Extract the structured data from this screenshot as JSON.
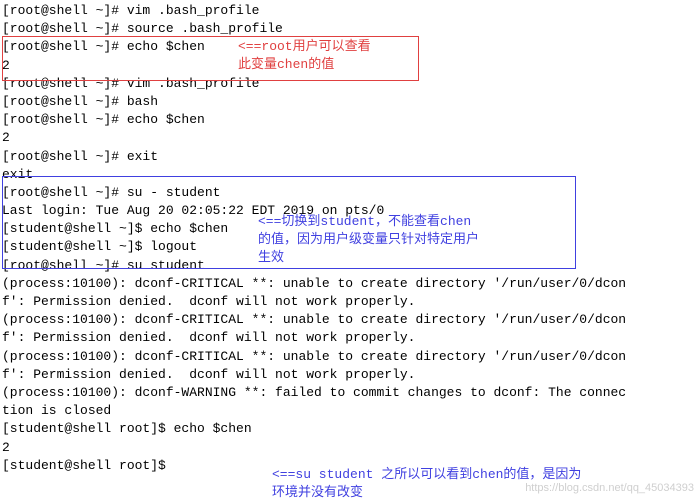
{
  "lines": [
    "[root@shell ~]# vim .bash_profile",
    "[root@shell ~]# source .bash_profile",
    "[root@shell ~]# echo $chen",
    "2",
    "[root@shell ~]# vim .bash_profile",
    "[root@shell ~]# bash",
    "[root@shell ~]# echo $chen",
    "2",
    "[root@shell ~]# exit",
    "exit",
    "[root@shell ~]# su - student",
    "Last login: Tue Aug 20 02:05:22 EDT 2019 on pts/0",
    "[student@shell ~]$ echo $chen",
    "",
    "[student@shell ~]$ logout",
    "[root@shell ~]# su student",
    "",
    "(process:10100): dconf-CRITICAL **: unable to create directory '/run/user/0/dcon",
    "f': Permission denied.  dconf will not work properly.",
    "",
    "(process:10100): dconf-CRITICAL **: unable to create directory '/run/user/0/dcon",
    "f': Permission denied.  dconf will not work properly.",
    "",
    "(process:10100): dconf-CRITICAL **: unable to create directory '/run/user/0/dcon",
    "f': Permission denied.  dconf will not work properly.",
    "",
    "(process:10100): dconf-WARNING **: failed to commit changes to dconf: The connec",
    "tion is closed",
    "[student@shell root]$ echo $chen",
    "2",
    "[student@shell root]$ "
  ],
  "annotations": {
    "red1": "<==root用户可以查看",
    "red2": "此变量chen的值",
    "blue1": "<==切换到student，不能查看chen",
    "blue2": "的值，因为用户级变量只针对特定用户",
    "blue3": "生效",
    "blue4": "<==su student 之所以可以看到chen的值，是因为",
    "blue5": "环境并没有改变"
  },
  "watermark": "https://blog.csdn.net/qq_45034393"
}
